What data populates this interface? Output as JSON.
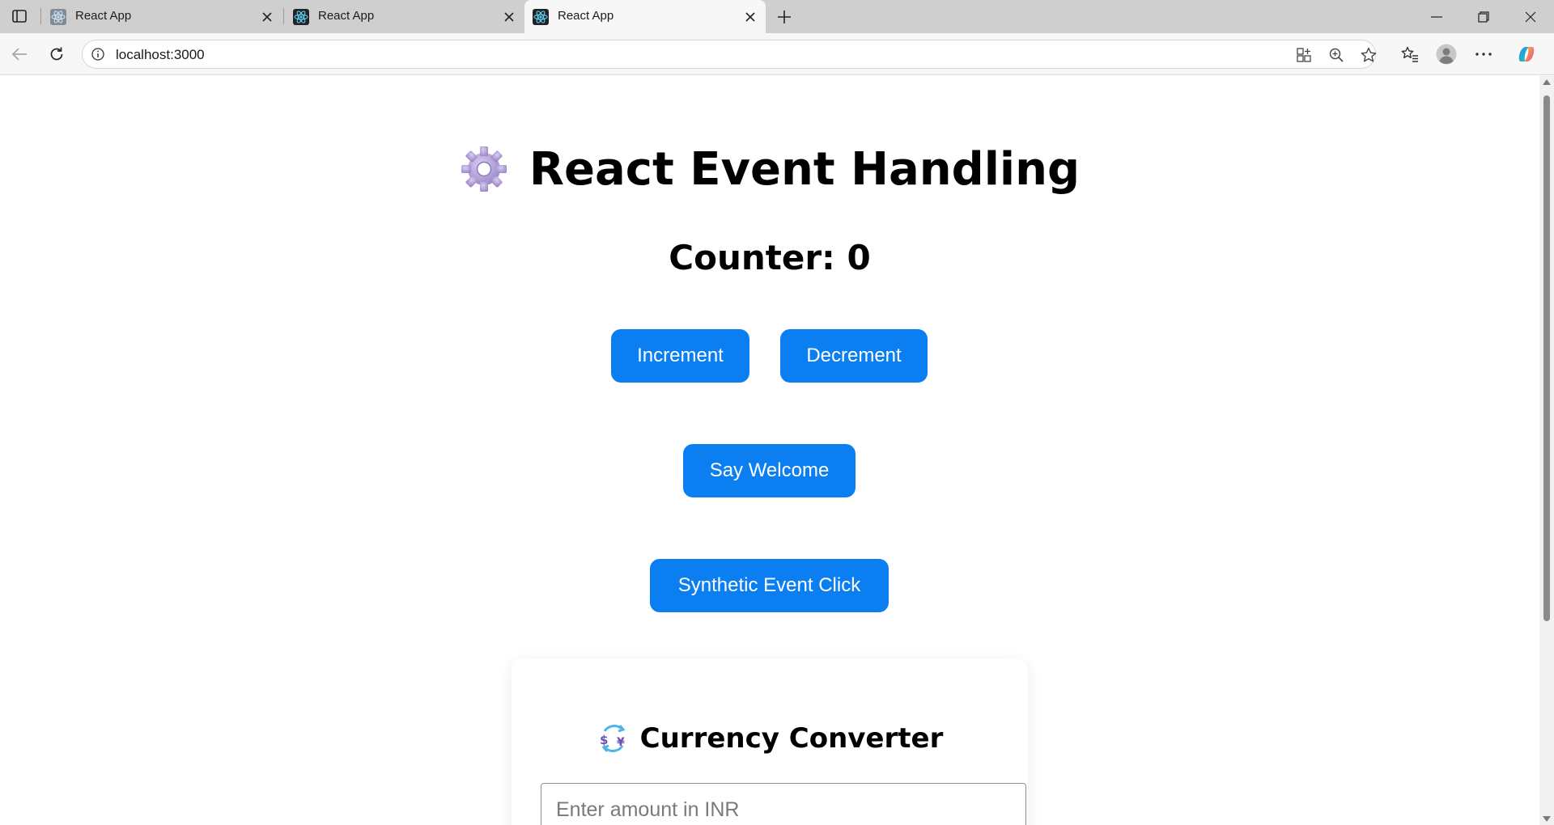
{
  "browser": {
    "tabs": [
      {
        "title": "React App",
        "active": false
      },
      {
        "title": "React App",
        "active": false
      },
      {
        "title": "React App",
        "active": true
      }
    ],
    "url": "localhost:3000"
  },
  "page": {
    "heading": "React Event Handling",
    "counter_text": "Counter: 0",
    "buttons": {
      "increment": "Increment",
      "decrement": "Decrement",
      "welcome": "Say Welcome",
      "synthetic": "Synthetic Event Click"
    },
    "converter": {
      "title": "Currency Converter",
      "amount_placeholder": "Enter amount in INR"
    }
  },
  "colors": {
    "button_bg": "#0b7ff2",
    "tab_strip": "#cfcfcf",
    "active_tab": "#f7f7f7"
  }
}
